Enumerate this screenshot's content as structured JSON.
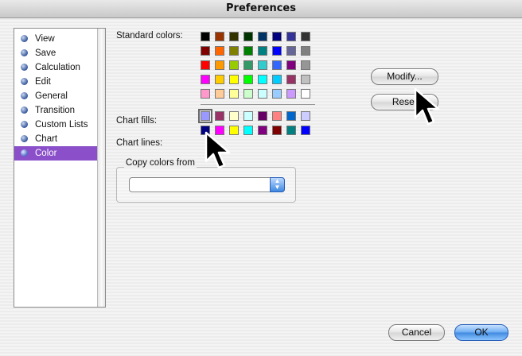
{
  "window": {
    "title": "Preferences"
  },
  "sidebar": {
    "items": [
      {
        "label": "View"
      },
      {
        "label": "Save"
      },
      {
        "label": "Calculation"
      },
      {
        "label": "Edit"
      },
      {
        "label": "General"
      },
      {
        "label": "Transition"
      },
      {
        "label": "Custom Lists"
      },
      {
        "label": "Chart"
      },
      {
        "label": "Color",
        "selected": true
      }
    ]
  },
  "color_panel": {
    "standard_colors_label": "Standard colors:",
    "chart_fills_label": "Chart fills:",
    "chart_lines_label": "Chart lines:",
    "standard_colors": [
      [
        "#000000",
        "#993300",
        "#333300",
        "#003300",
        "#003366",
        "#000080",
        "#333399",
        "#333333"
      ],
      [
        "#800000",
        "#ff6600",
        "#808000",
        "#008000",
        "#008080",
        "#0000ff",
        "#666699",
        "#808080"
      ],
      [
        "#ff0000",
        "#ff9900",
        "#99cc00",
        "#339966",
        "#33cccc",
        "#3366ff",
        "#800080",
        "#969696"
      ],
      [
        "#ff00ff",
        "#ffcc00",
        "#ffff00",
        "#00ff00",
        "#00ffff",
        "#00ccff",
        "#993366",
        "#c0c0c0"
      ],
      [
        "#ff99cc",
        "#ffcc99",
        "#ffff99",
        "#ccffcc",
        "#ccffff",
        "#99ccff",
        "#cc99ff",
        "#ffffff"
      ]
    ],
    "chart_fills": [
      "#9999ff",
      "#993366",
      "#ffffcc",
      "#ccffff",
      "#660066",
      "#ff8080",
      "#0066cc",
      "#ccccff"
    ],
    "chart_lines": [
      "#000080",
      "#ff00ff",
      "#ffff00",
      "#00ffff",
      "#800080",
      "#800000",
      "#008080",
      "#0000ff"
    ],
    "modify_button": "Modify...",
    "reset_button": "Reset",
    "copy_colors_from_label": "Copy colors from",
    "copy_colors_from_value": ""
  },
  "footer": {
    "cancel_button": "Cancel",
    "ok_button": "OK"
  },
  "colors": {
    "selection": "#8a4fc9",
    "default_button": "#3f89e0"
  }
}
